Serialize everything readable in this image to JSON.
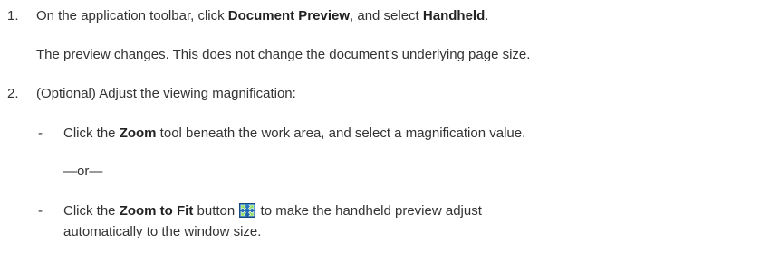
{
  "steps": [
    {
      "number": "1.",
      "text_pre": "On the application toolbar, click ",
      "bold1": "Document Preview",
      "text_mid": ", and select ",
      "bold2": "Handheld",
      "text_post": "."
    },
    {
      "number": "2.",
      "text": "(Optional) Adjust the viewing magnification:"
    }
  ],
  "step1_note": "The preview changes. This does not change the document's underlying page size.",
  "bullets": [
    {
      "dash": "-",
      "text_pre": "Click the ",
      "bold": "Zoom",
      "text_post": " tool beneath the work area, and select a magnification value."
    },
    {
      "dash": "-",
      "text_pre": "Click the ",
      "bold": "Zoom to Fit",
      "text_mid": " button ",
      "icon": "zoom-to-fit-icon",
      "text_post": " to make the handheld preview adjust",
      "text_line2": "automatically to the window size."
    }
  ],
  "or_separator": "—or—"
}
